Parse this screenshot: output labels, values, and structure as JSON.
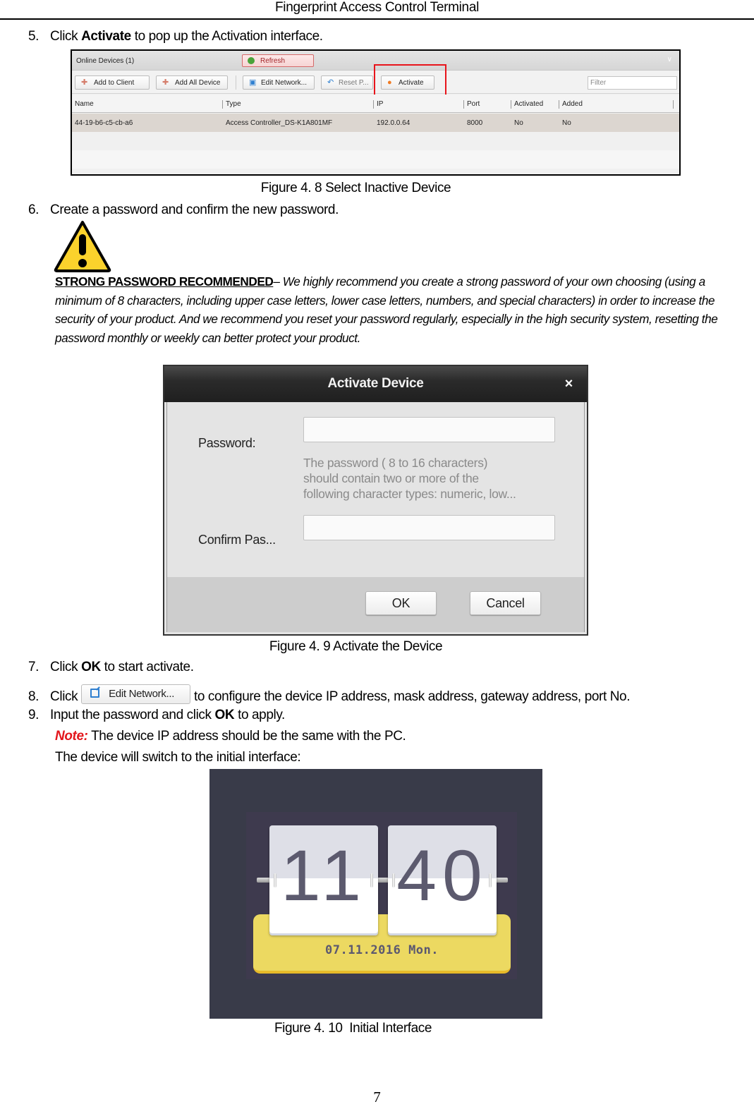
{
  "header": {
    "title": "Fingerprint Access Control Terminal"
  },
  "steps": [
    {
      "num": "5.",
      "pre": "Click ",
      "bold": "Activate",
      "post": " to pop up the Activation interface."
    },
    {
      "num": "6.",
      "text": "Create a password and confirm the new password."
    },
    {
      "num": "7.",
      "pre": "Click ",
      "bold": "OK",
      "post": " to start activate."
    },
    {
      "num": "8.",
      "pre": "Click ",
      "post": " to configure the device IP address, mask address, gateway address, port No."
    },
    {
      "num": "9.",
      "pre": "Input the password and click ",
      "bold": "OK",
      "post": " to apply."
    }
  ],
  "note": {
    "label": "Note:",
    "text": " The device IP address should be the same with the PC."
  },
  "switch_text": "The device will switch to the initial interface:",
  "figure_4_8": {
    "caption": "Figure 4. 8 Select Inactive Device",
    "panel_title": "Online Devices (1)",
    "refresh_label": "Refresh",
    "collapse_icon": "double-chevron-down-icon",
    "toolbar": {
      "add_to_client": "Add to Client",
      "add_all_device": "Add All Device",
      "edit_network": "Edit Network...",
      "reset_password": "Reset P...",
      "activate": "Activate",
      "filter_placeholder": "Filter"
    },
    "columns": [
      "Name",
      "Type",
      "IP",
      "Port",
      "Activated",
      "Added"
    ],
    "rows": [
      [
        "44-19-b6-c5-cb-a6",
        "Access Controller_DS-K1A801MF",
        "192.0.0.64",
        "8000",
        "No",
        "No"
      ]
    ],
    "highlight_color": "#e8141b"
  },
  "warning": {
    "icon": "warning-triangle-icon",
    "heading": "STRONG PASSWORD RECOMMENDED",
    "dash": "– ",
    "text": "We highly recommend you create a strong password of your own choosing (using a minimum of 8 characters, including upper case letters, lower case letters, numbers, and special characters) in order to increase the security of your product. And we recommend you reset your password regularly, especially in the high security system, resetting the password monthly or weekly can better protect your product."
  },
  "figure_4_9": {
    "caption": "Figure 4. 9 Activate the Device",
    "dialog_title": "Activate Device",
    "close_symbol": "×",
    "password_label": "Password:",
    "password_value": "",
    "hint_lines": [
      "The password ( 8 to 16 characters)",
      "should contain two or more of the",
      "following character types: numeric, low..."
    ],
    "confirm_label": "Confirm Pas...",
    "confirm_value": "",
    "ok_label": "OK",
    "cancel_label": "Cancel"
  },
  "inline_button": {
    "label": "Edit Network..."
  },
  "figure_4_10": {
    "caption": "Figure 4. 10  Initial Interface",
    "hours": "11",
    "minutes": "40",
    "date": "07.11.2016 Mon."
  },
  "page_number": "7"
}
